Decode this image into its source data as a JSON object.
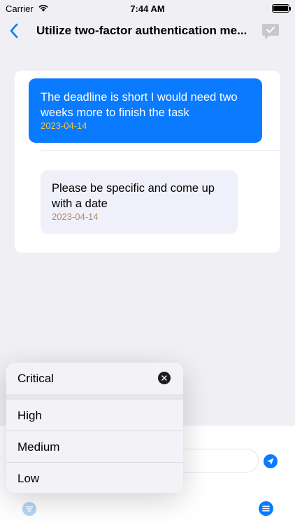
{
  "status_bar": {
    "carrier": "Carrier",
    "time": "7:44 AM"
  },
  "nav": {
    "title": "Utilize two-factor authentication me...",
    "back_icon": "chevron-left-icon",
    "action_icon": "checkmark-bubble-icon"
  },
  "messages": [
    {
      "direction": "outgoing",
      "text": "The deadline is short I would need two weeks more to finish the task",
      "date": "2023-04-14"
    },
    {
      "direction": "incoming",
      "text": "Please be specific and come up with a date",
      "date": "2023-04-14"
    }
  ],
  "priority_menu": {
    "selected": "Critical",
    "options": [
      "High",
      "Medium",
      "Low"
    ]
  },
  "colors": {
    "accent": "#0a7aff",
    "outgoing_date": "#f4c44a",
    "incoming_bubble": "#f0f0fb",
    "incoming_date": "#b08a6a",
    "background": "#efeff4"
  }
}
